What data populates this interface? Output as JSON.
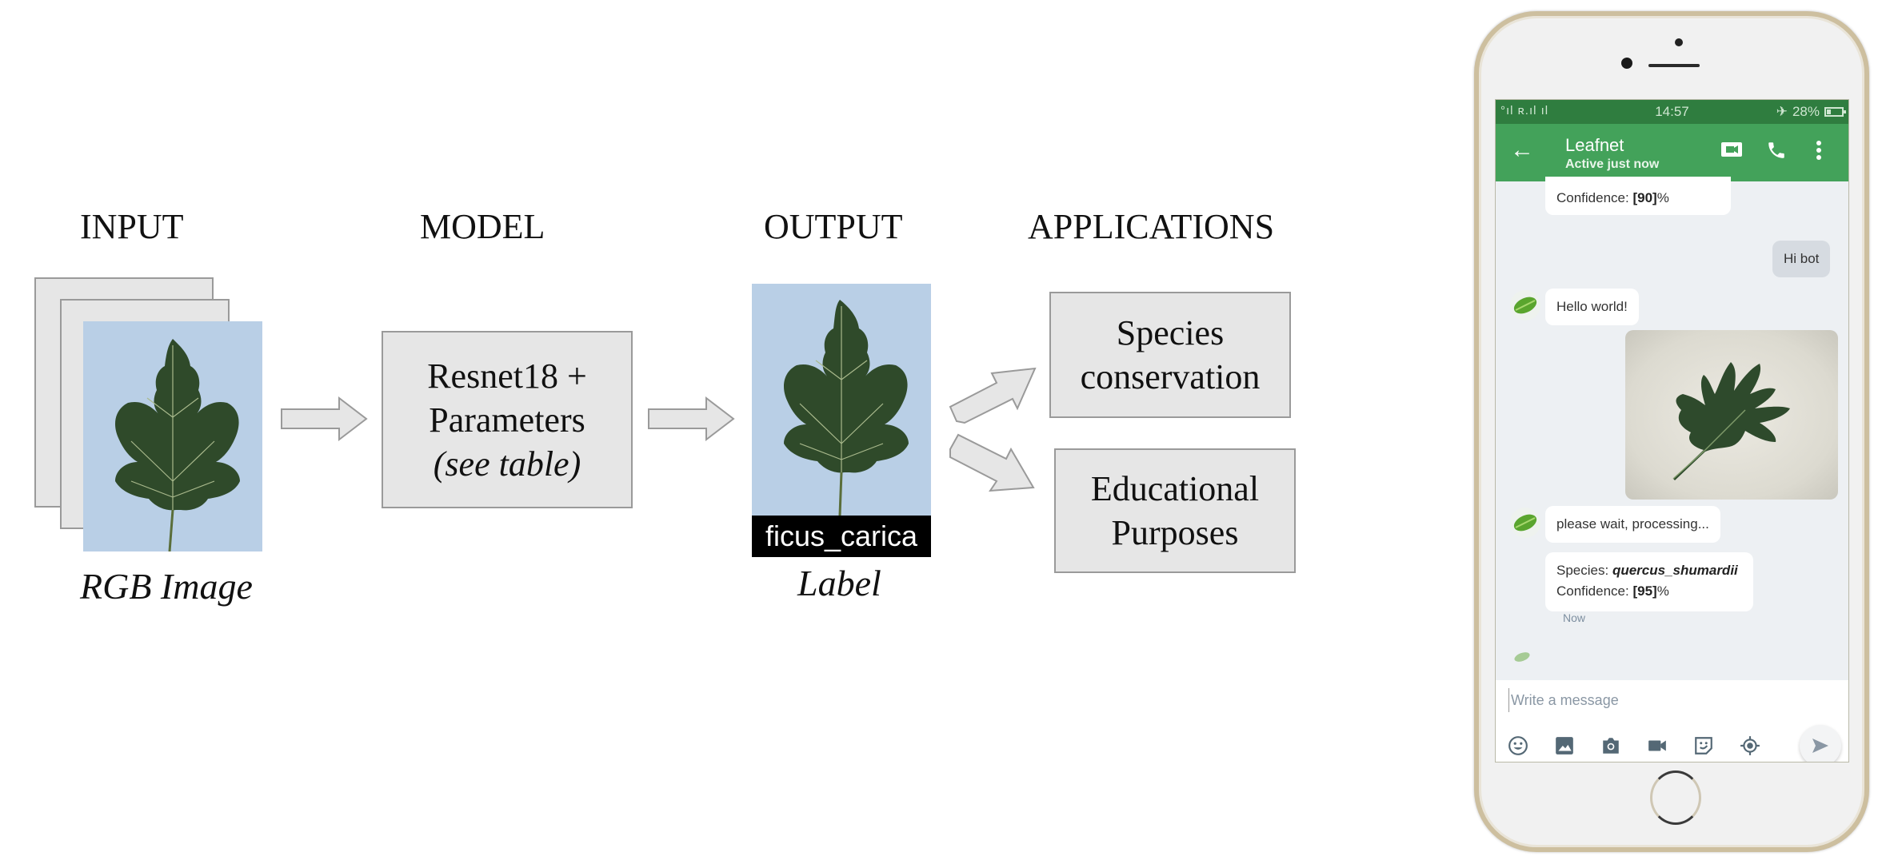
{
  "diagram": {
    "headings": {
      "input": "INPUT",
      "model": "MODEL",
      "output": "OUTPUT",
      "applications": "APPLICATIONS"
    },
    "input": {
      "caption": "RGB Image",
      "image": "fig-leaf-photo"
    },
    "model": {
      "line1": "Resnet18 +",
      "line2": "Parameters",
      "line3": "(see table)"
    },
    "output": {
      "predicted_label": "ficus_carica",
      "caption": "Label",
      "image": "fig-leaf-photo"
    },
    "applications": [
      {
        "line1": "Species",
        "line2": "conservation"
      },
      {
        "line1": "Educational",
        "line2": "Purposes"
      }
    ],
    "colors": {
      "box_fill": "#e6e6e6",
      "box_border": "#9a9a9a",
      "photo_background": "#b9cfe6",
      "leaf": "#2f4a2a"
    }
  },
  "phone": {
    "status_bar": {
      "signal": "°ıl ʀ.ıl ıl",
      "time": "14:57",
      "battery": "28%"
    },
    "app_bar": {
      "back_icon": "arrow-left-icon",
      "title": "Leafnet",
      "subtitle": "Active just now",
      "actions": [
        "video-call-icon",
        "phone-icon",
        "more-vert-icon"
      ]
    },
    "messages": [
      {
        "from": "bot",
        "partial": true,
        "confidence_label": "Confidence: ",
        "confidence_value": "[90]",
        "confidence_suffix": "%"
      },
      {
        "from": "user",
        "text": "Hi bot"
      },
      {
        "from": "bot",
        "text": "Hello world!"
      },
      {
        "from": "user",
        "type": "image",
        "image": "oak-leaf-photo"
      },
      {
        "from": "bot",
        "text": "please wait, processing..."
      },
      {
        "from": "bot",
        "species_label": "Species: ",
        "species_value": "quercus_shumardii",
        "confidence_label": "Confidence: ",
        "confidence_value": "[95]",
        "confidence_suffix": "%",
        "time": "Now"
      }
    ],
    "composer": {
      "placeholder": "Write a message",
      "tools": [
        "emoji-icon",
        "image-icon",
        "camera-icon",
        "video-icon",
        "sticker-icon",
        "location-icon"
      ],
      "send": "send-icon"
    },
    "colors": {
      "status_bar": "#2f7d3f",
      "app_bar": "#43a25a",
      "chat_bg": "#edf0f3",
      "user_bubble": "#d6dbe1",
      "icon_gray": "#546875"
    }
  }
}
